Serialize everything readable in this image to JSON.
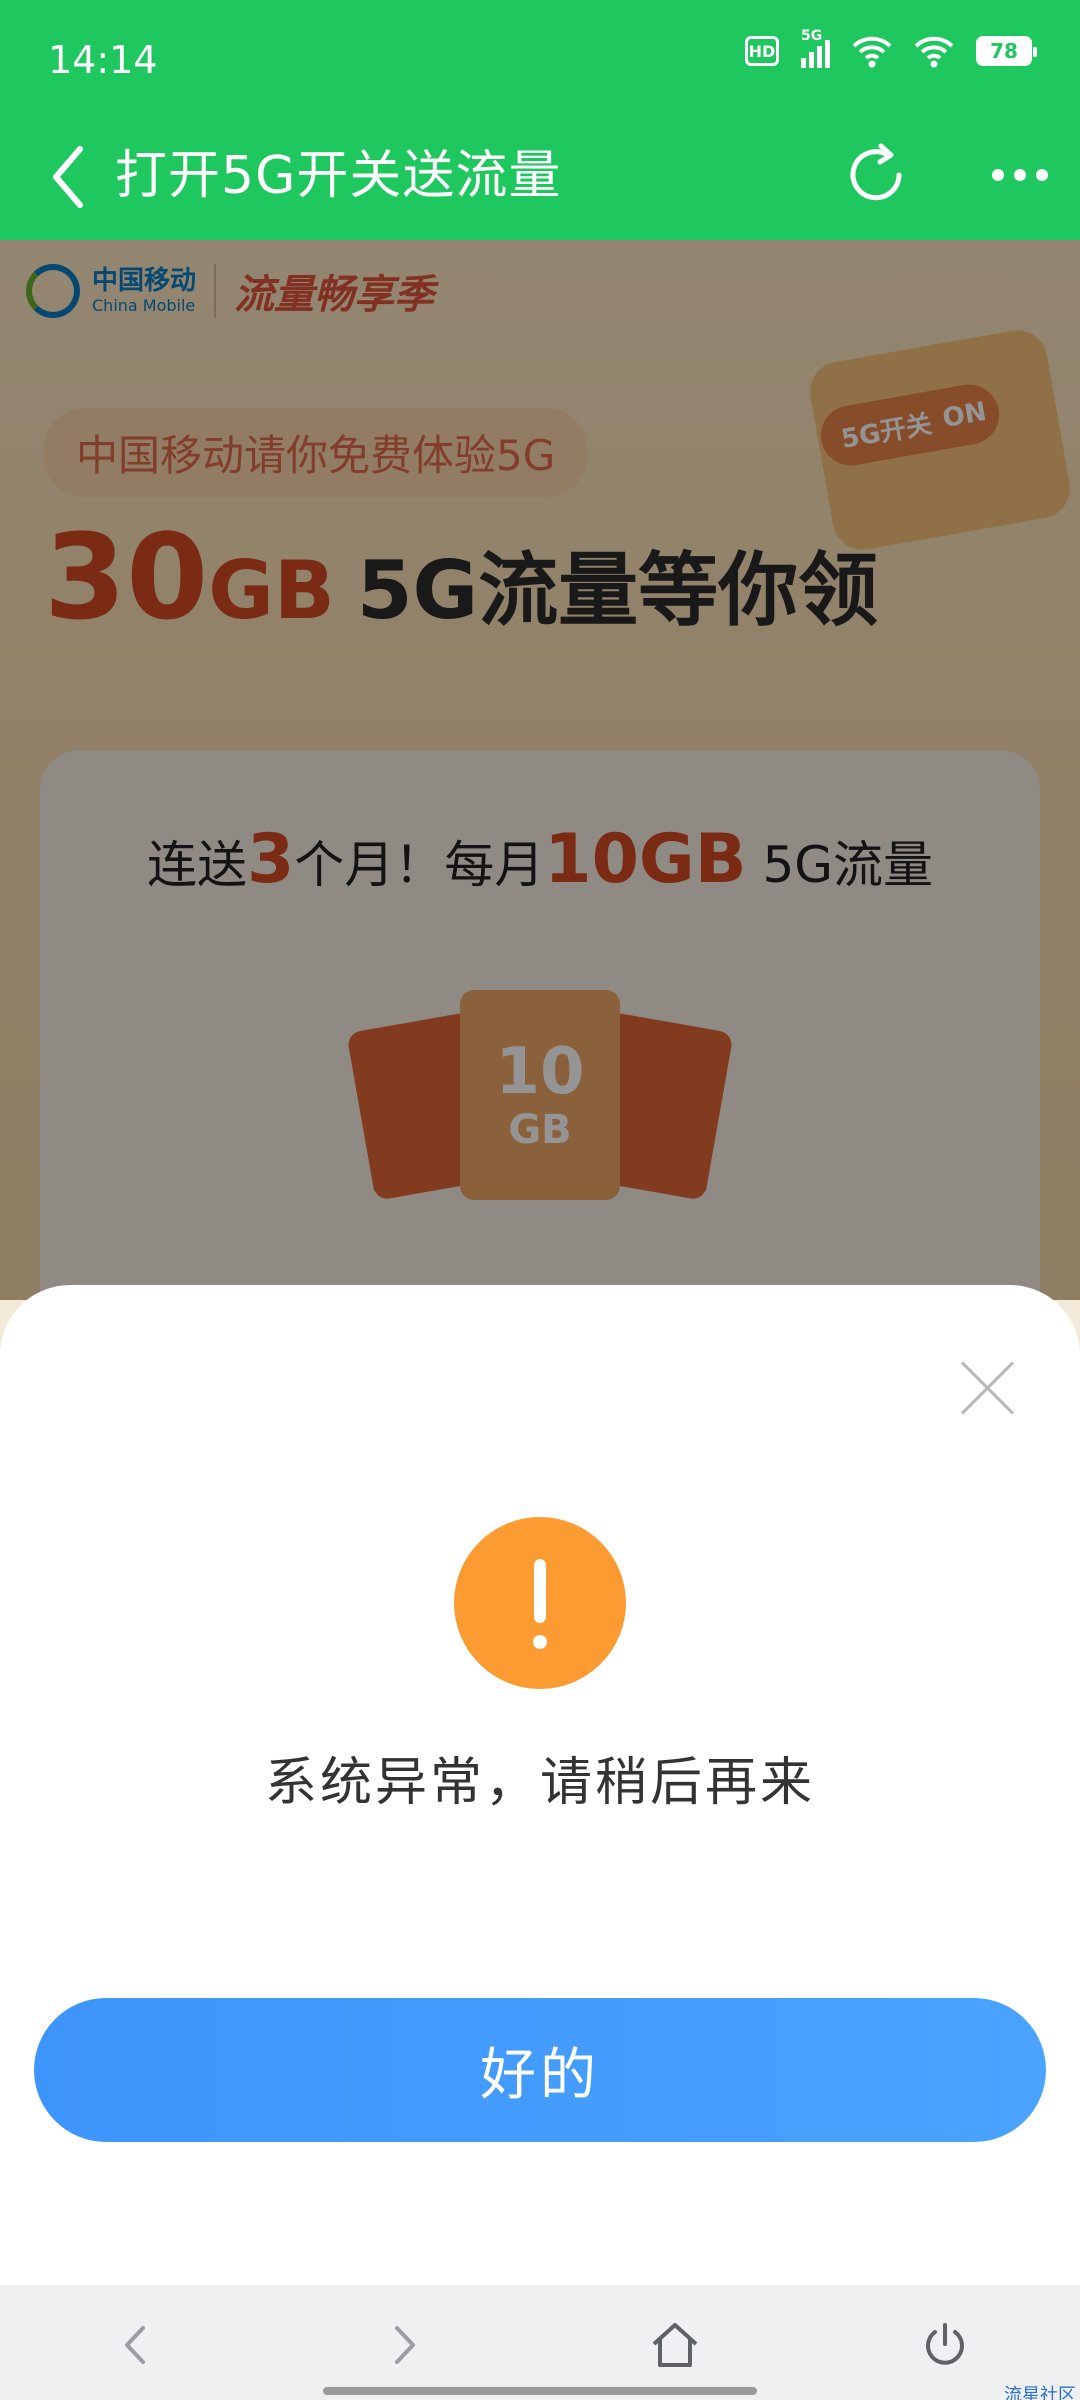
{
  "status_bar": {
    "time": "14:14",
    "hd_label": "HD",
    "network_label": "5G",
    "battery": "78"
  },
  "nav": {
    "title": "打开5G开关送流量",
    "back_icon": "chevron-left-icon",
    "refresh_icon": "refresh-icon",
    "more_icon": "more-dots-icon"
  },
  "promo": {
    "brand_cn": "中国移动",
    "brand_en": "China Mobile",
    "slogan": "流量畅享季",
    "switch_label": "5G开关",
    "switch_state": "ON",
    "invite": "中国移动请你免费体验5G",
    "headline_num": "30",
    "headline_unit": "GB",
    "headline_rest": "5G流量等你领",
    "offer_prefix": "连送",
    "offer_months": "3",
    "offer_mid": "个月！每月",
    "offer_amount": "10GB",
    "offer_suffix": " 5G流量",
    "envelope_value": "10",
    "envelope_unit": "GB"
  },
  "dialog": {
    "close_icon": "close-icon",
    "icon": "warning-icon",
    "icon_color": "#fb9b32",
    "message": "系统异常，请稍后再来",
    "ok_label": "好的",
    "button_color": "#3d94fb"
  },
  "browser_bar": {
    "icons": [
      "back-arrow-icon",
      "forward-arrow-icon",
      "home-icon",
      "power-icon"
    ],
    "watermark": "流星社区"
  },
  "colors": {
    "header_green": "#1fc75f",
    "accent_orange": "#d44b22"
  }
}
